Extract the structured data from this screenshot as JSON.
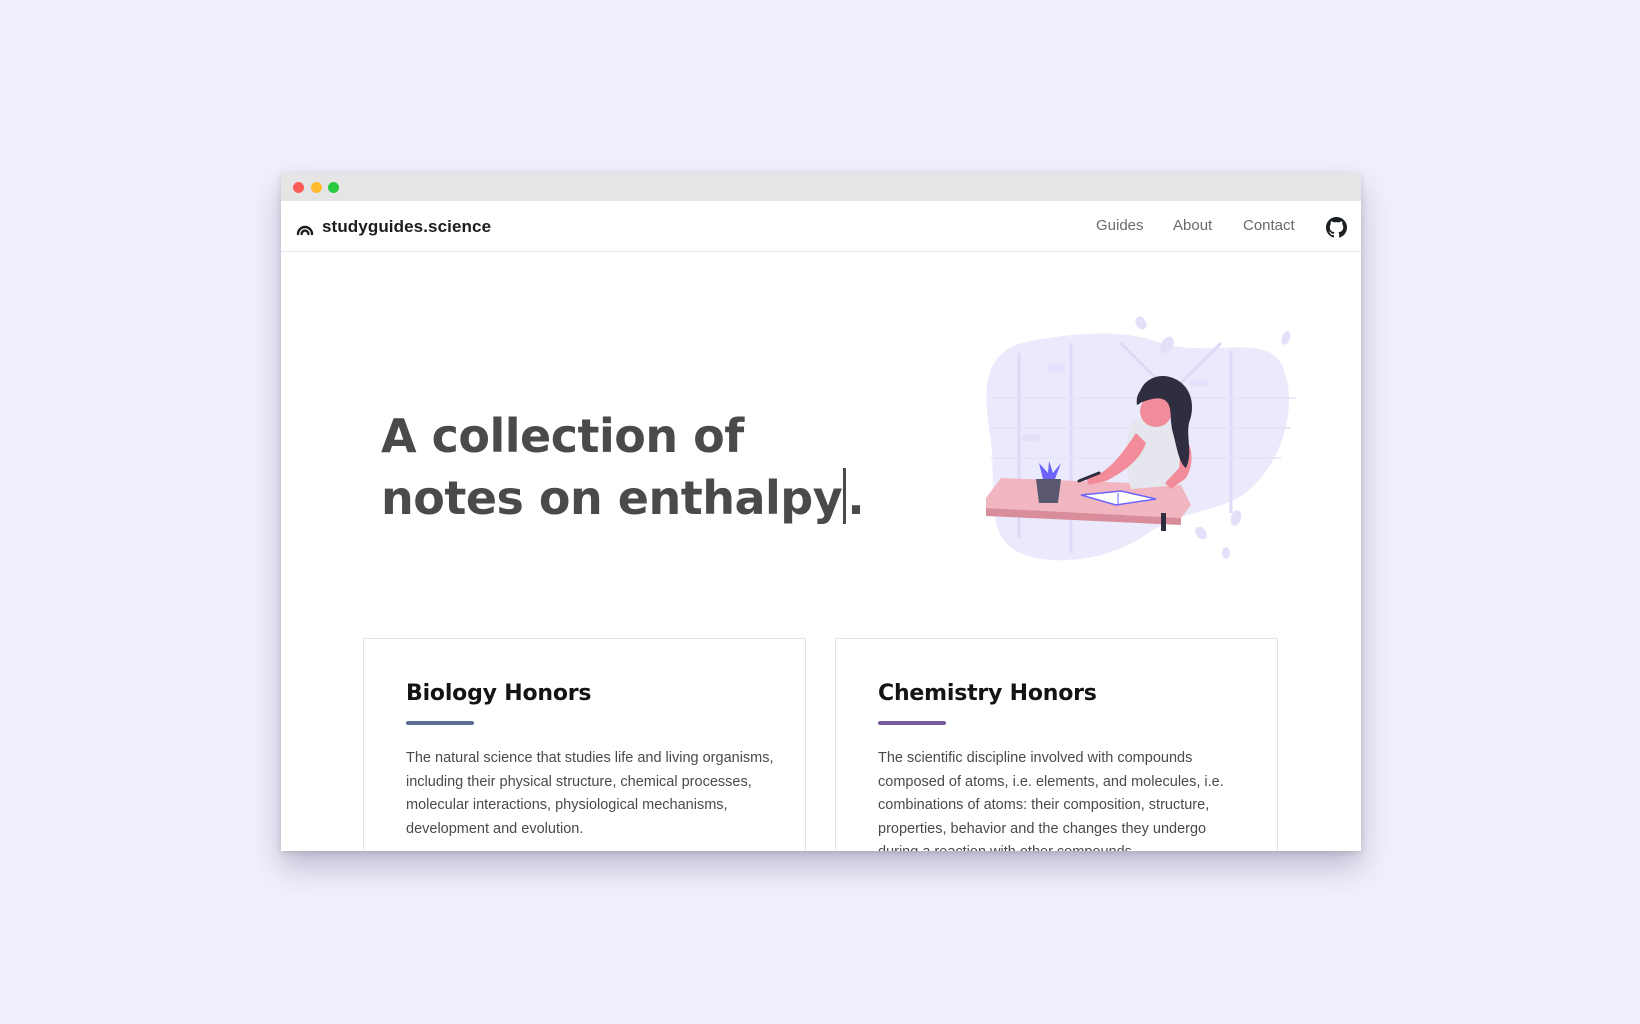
{
  "site": {
    "brand": "studyguides.science",
    "nav": {
      "guides": "Guides",
      "about": "About",
      "contact": "Contact"
    }
  },
  "hero": {
    "line1": "A collection of",
    "line2_prefix": "notes on enthalpy",
    "line2_suffix": "."
  },
  "cards": [
    {
      "title": "Biology Honors",
      "accent": "#5a6f94",
      "description": "The natural science that studies life and living organisms, including their physical structure, chemical processes, molecular interactions, physiological mechanisms, development and evolution."
    },
    {
      "title": "Chemistry Honors",
      "accent": "#7b5b9a",
      "description": "The scientific discipline involved with compounds composed of atoms, i.e. elements, and molecules, i.e. combinations of atoms: their composition, structure, properties, behavior and the changes they undergo during a reaction with other compounds."
    }
  ],
  "colors": {
    "page_background": "#efeffd",
    "window_titlebar": "#e5e5e5",
    "hero_text": "#4a4a4a",
    "illustration_blob": "#ebeafd",
    "illustration_desk": "#f1b6c0",
    "illustration_hair": "#2f2e41"
  },
  "icons": {
    "brand": "logo-icon",
    "github": "github-icon"
  }
}
